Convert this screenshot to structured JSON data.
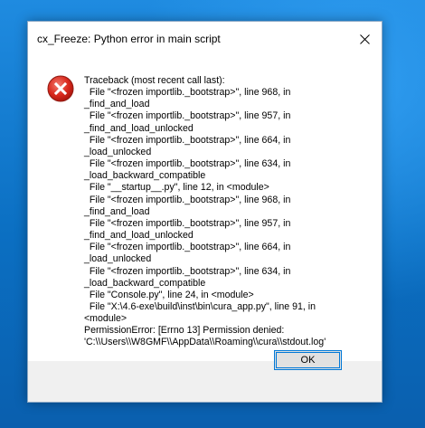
{
  "window": {
    "title": "cx_Freeze: Python error in main script",
    "close_icon": "close-icon"
  },
  "dialog": {
    "icon": "error-icon",
    "message": "Traceback (most recent call last):\n  File \"<frozen importlib._bootstrap>\", line 968, in\n_find_and_load\n  File \"<frozen importlib._bootstrap>\", line 957, in\n_find_and_load_unlocked\n  File \"<frozen importlib._bootstrap>\", line 664, in\n_load_unlocked\n  File \"<frozen importlib._bootstrap>\", line 634, in\n_load_backward_compatible\n  File \"__startup__.py\", line 12, in <module>\n  File \"<frozen importlib._bootstrap>\", line 968, in\n_find_and_load\n  File \"<frozen importlib._bootstrap>\", line 957, in\n_find_and_load_unlocked\n  File \"<frozen importlib._bootstrap>\", line 664, in\n_load_unlocked\n  File \"<frozen importlib._bootstrap>\", line 634, in\n_load_backward_compatible\n  File \"Console.py\", line 24, in <module>\n  File \"X:\\4.6-exe\\build\\inst\\bin\\cura_app.py\", line 91, in\n<module>\nPermissionError: [Errno 13] Permission denied:\n'C:\\\\Users\\\\W8GMF\\\\AppData\\\\Roaming\\\\cura\\\\stdout.log'",
    "ok_label": "OK"
  },
  "colors": {
    "accent": "#0078d7",
    "error_red": "#e81123",
    "desktop_blue": "#0b6fc2"
  }
}
